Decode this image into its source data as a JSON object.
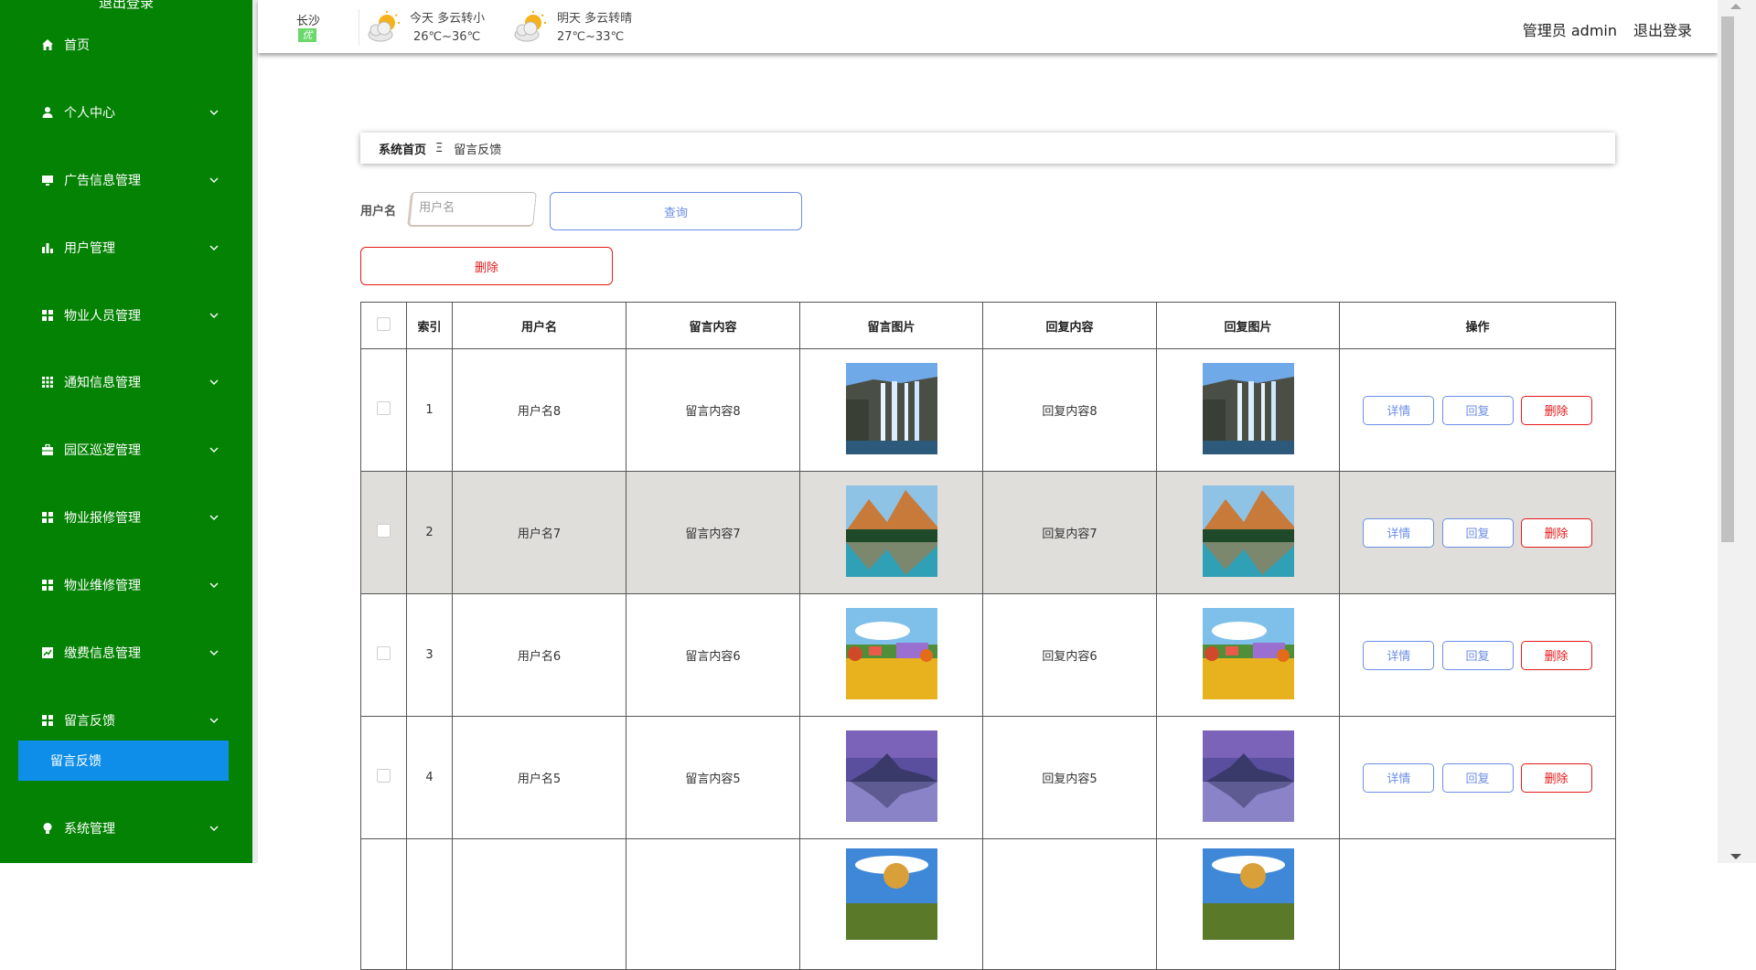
{
  "sidebar": {
    "top_logout": "退出登录",
    "items": [
      {
        "label": "首页",
        "icon": "home-icon",
        "has_chevron": false
      },
      {
        "label": "个人中心",
        "icon": "user-icon",
        "has_chevron": true
      },
      {
        "label": "广告信息管理",
        "icon": "monitor-icon",
        "has_chevron": true
      },
      {
        "label": "用户管理",
        "icon": "bar-chart-icon",
        "has_chevron": true
      },
      {
        "label": "物业人员管理",
        "icon": "grid-icon",
        "has_chevron": true
      },
      {
        "label": "通知信息管理",
        "icon": "apps-icon",
        "has_chevron": true
      },
      {
        "label": "园区巡逻管理",
        "icon": "briefcase-icon",
        "has_chevron": true
      },
      {
        "label": "物业报修管理",
        "icon": "grid-icon",
        "has_chevron": true
      },
      {
        "label": "物业维修管理",
        "icon": "grid-icon",
        "has_chevron": true
      },
      {
        "label": "缴费信息管理",
        "icon": "chart-icon",
        "has_chevron": true
      },
      {
        "label": "留言反馈",
        "icon": "grid-icon",
        "has_chevron": true
      },
      {
        "label": "系统管理",
        "icon": "bulb-icon",
        "has_chevron": true
      }
    ],
    "active_sub": "留言反馈",
    "color": "#038203",
    "active_color": "#0f8ee9"
  },
  "header": {
    "city": "长沙",
    "aqi": "优",
    "today": {
      "line1": "今天  多云转小",
      "line2": "26℃~36℃",
      "icon": "partly-cloudy-icon"
    },
    "tomorrow": {
      "line1": "明天  多云转晴",
      "line2": "27℃~33℃",
      "icon": "partly-cloudy-icon"
    },
    "admin": "管理员 admin",
    "logout": "退出登录"
  },
  "breadcrumb": {
    "home": "系统首页",
    "separator": "Ξ",
    "current": "留言反馈"
  },
  "search": {
    "label": "用户名",
    "placeholder": "用户名",
    "query_button": "查询",
    "delete_button": "删除"
  },
  "table": {
    "columns": [
      "索引",
      "用户名",
      "留言内容",
      "留言图片",
      "回复内容",
      "回复图片",
      "操作"
    ],
    "rows": [
      {
        "index": "1",
        "username": "用户名8",
        "content": "留言内容8",
        "reply": "回复内容8",
        "image": "waterfall"
      },
      {
        "index": "2",
        "username": "用户名7",
        "content": "留言内容7",
        "reply": "回复内容7",
        "image": "mountain-lake"
      },
      {
        "index": "3",
        "username": "用户名6",
        "content": "留言内容6",
        "reply": "回复内容6",
        "image": "flower-field"
      },
      {
        "index": "4",
        "username": "用户名5",
        "content": "留言内容5",
        "reply": "回复内容5",
        "image": "dusk-mountain"
      },
      {
        "index": "",
        "username": "",
        "content": "",
        "reply": "",
        "image": "autumn-sky"
      }
    ],
    "actions": {
      "detail": "详情",
      "reply": "回复",
      "delete": "删除"
    },
    "accent": "#6b8ee6",
    "danger": "#e61818"
  }
}
